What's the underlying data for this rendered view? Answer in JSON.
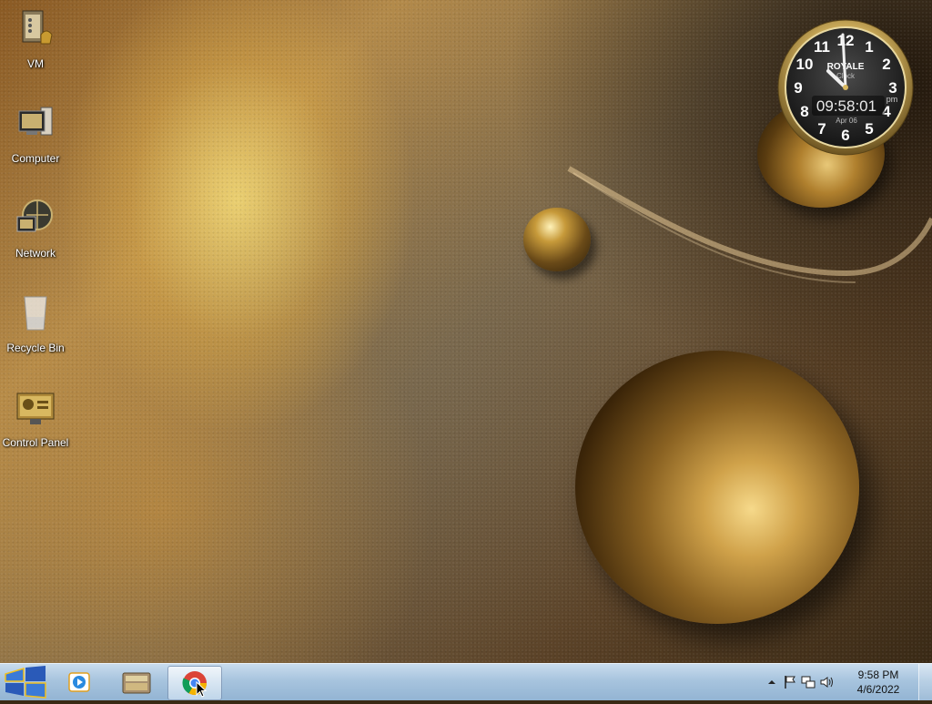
{
  "desktop": {
    "icons": [
      {
        "label": "VM",
        "icon": "vm-folder-icon"
      },
      {
        "label": "Computer",
        "icon": "computer-icon"
      },
      {
        "label": "Network",
        "icon": "network-icon"
      },
      {
        "label": "Recycle Bin",
        "icon": "recycle-bin-icon"
      },
      {
        "label": "Control Panel",
        "icon": "control-panel-icon"
      }
    ]
  },
  "clock_gadget": {
    "brand": "ROYALE",
    "sub": "Clock",
    "time": "09:58:01",
    "ampm": "pm",
    "date": "Apr 06",
    "numerals": [
      "12",
      "1",
      "2",
      "3",
      "4",
      "5",
      "6",
      "7",
      "8",
      "9",
      "10",
      "11"
    ]
  },
  "taskbar": {
    "start_icon": "windows-orb-icon",
    "pinned": [
      {
        "name": "media-player",
        "icon": "media-player-icon"
      },
      {
        "name": "file-manager",
        "icon": "file-manager-icon"
      },
      {
        "name": "chrome",
        "icon": "chrome-icon",
        "active": true
      }
    ],
    "tray": {
      "icons": [
        "show-hidden-icons-icon",
        "action-center-flag-icon",
        "network-tray-icon",
        "volume-icon"
      ],
      "time": "9:58 PM",
      "date": "4/6/2022"
    }
  },
  "colors": {
    "taskbar": "#a7c4de",
    "wallpaper_gold": "#c79a3a"
  }
}
